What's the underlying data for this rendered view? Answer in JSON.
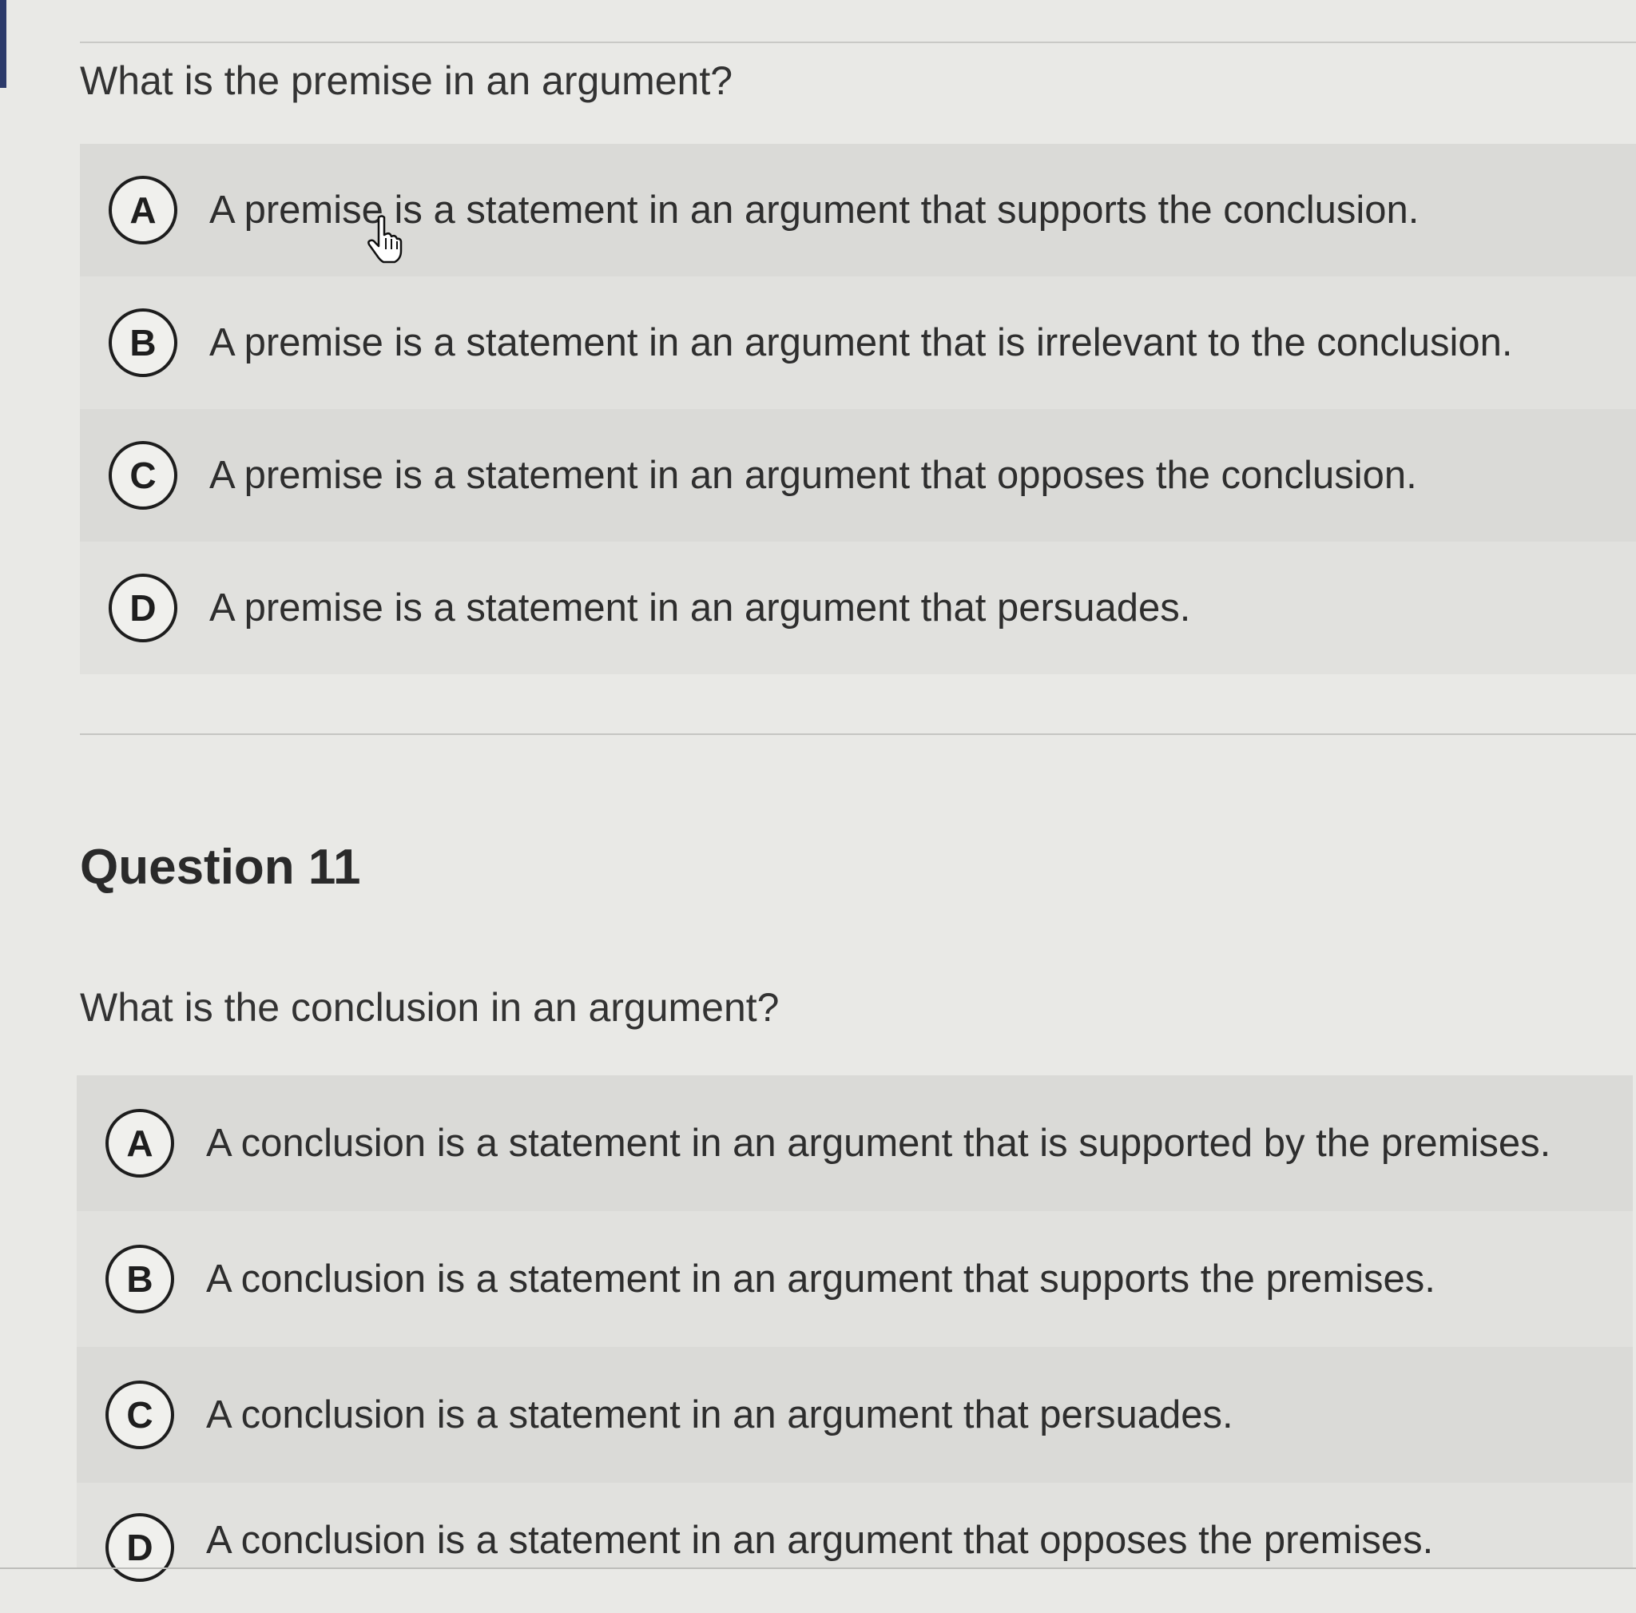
{
  "question_10": {
    "prompt": "What is the premise in an argument?",
    "options": [
      {
        "letter": "A",
        "text": "A premise is a statement in an argument that supports the conclusion."
      },
      {
        "letter": "B",
        "text": "A premise is a statement in an argument that is irrelevant to the conclusion."
      },
      {
        "letter": "C",
        "text": "A premise is a statement in an argument that opposes the conclusion."
      },
      {
        "letter": "D",
        "text": "A premise is a statement in an argument that persuades."
      }
    ]
  },
  "question_11": {
    "heading": "Question 11",
    "prompt": "What is the conclusion in an argument?",
    "options": [
      {
        "letter": "A",
        "text": "A conclusion is a statement in an argument that is supported by the premises."
      },
      {
        "letter": "B",
        "text": "A conclusion is a statement in an argument that supports the premises."
      },
      {
        "letter": "C",
        "text": "A conclusion is a statement in an argument that persuades."
      },
      {
        "letter": "D",
        "text": "A conclusion is a statement in an argument that opposes the premises."
      }
    ]
  },
  "cursor": {
    "icon": "hand-pointer-icon"
  }
}
